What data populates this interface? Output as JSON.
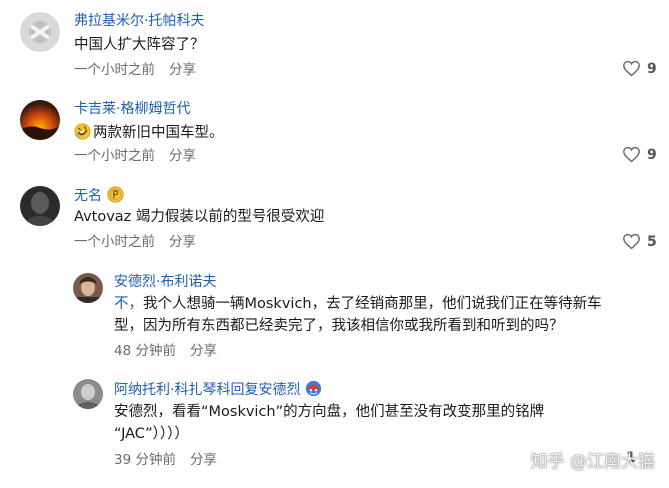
{
  "comments": [
    {
      "author": "弗拉基米尔·托帕科夫",
      "text": "中国人扩大阵容了？",
      "time": "一个小时之前",
      "share": "分享",
      "likes": "9"
    },
    {
      "author": "卡吉莱·格柳姆哲代",
      "emoji": "rofl-emoji",
      "text": "两款新旧中国车型。",
      "time": "一个小时之前",
      "share": "分享",
      "likes": "9"
    },
    {
      "author": "无名",
      "badge": "coin-badge-icon",
      "text": "Avtovaz 竭力假装以前的型号很受欢迎",
      "time": "一个小时之前",
      "share": "分享",
      "likes": "5"
    }
  ],
  "replies": [
    {
      "author": "安德烈·布利诺夫",
      "text_highlight": "不，",
      "text_line1_rest": "我个人想骑一辆Moskvich，去了经销商那里，他们说我们正在等待新车",
      "text_line2": "型，因为所有东西都已经卖完了，我该相信你或我所看到和听到的吗？",
      "time": "48 分钟前",
      "share": "分享"
    },
    {
      "author": "阿纳托利·科扎琴科回复安德烈",
      "badge": "captain-shield-icon",
      "text_line1": "安德烈，看看“Moskvich”的方向盘，他们甚至没有改变那里的铭牌",
      "text_line2": "“JAC”））））",
      "time": "39 分钟前",
      "share": "分享",
      "likes": "1"
    }
  ],
  "watermark": "知乎 @江南大猫",
  "colors": {
    "author_name": "#1d5fb4",
    "meta_text": "#6b6b6b",
    "background": "#ffffff"
  }
}
